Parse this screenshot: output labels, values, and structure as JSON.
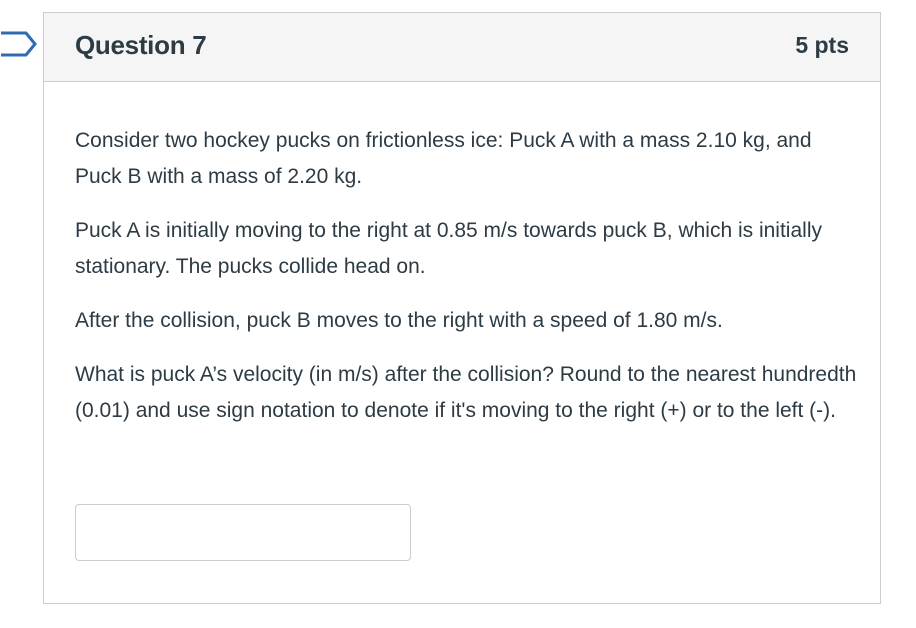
{
  "question": {
    "title": "Question 7",
    "points": "5 pts",
    "paragraphs": [
      "Consider two hockey pucks on frictionless ice: Puck A with a mass 2.10 kg, and Puck B with a mass of 2.20 kg.",
      "Puck A is initially moving to the right at 0.85 m/s towards puck B, which is initially stationary. The pucks collide head on.",
      "After the collision, puck B moves to the right with a speed of 1.80 m/s.",
      "What is puck A’s velocity (in m/s) after the collision? Round to the nearest hundredth (0.01) and use sign notation to denote if it's moving to the right (+) or to the left (-)."
    ],
    "answer": {
      "value": "",
      "placeholder": ""
    }
  },
  "colors": {
    "text": "#2d3b45",
    "header_bg": "#f5f5f5",
    "border": "#c7cdd1",
    "flag_stroke": "#2d6bb3"
  },
  "icons": {
    "flag": "bookmark-flag-icon"
  }
}
